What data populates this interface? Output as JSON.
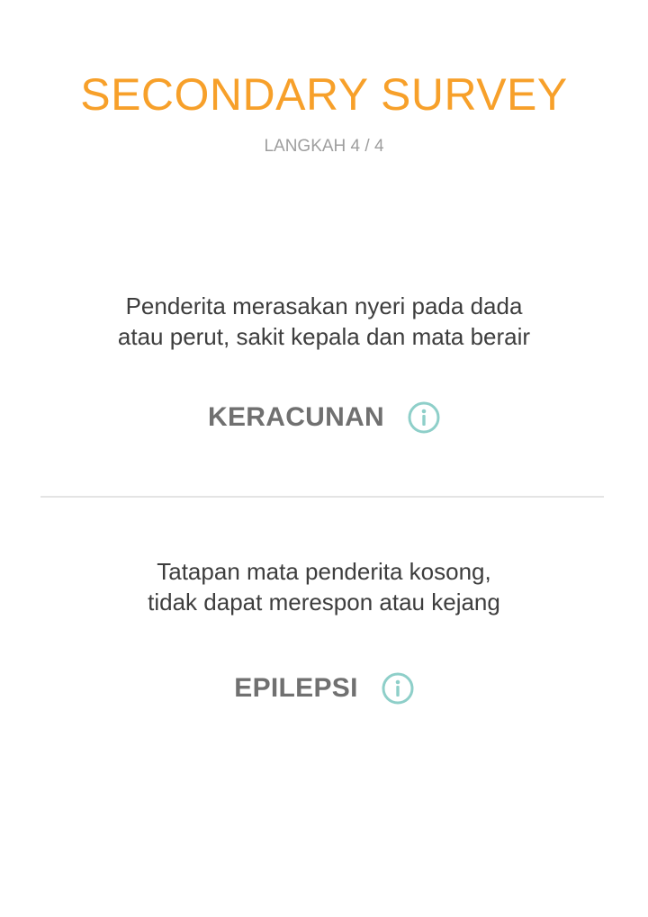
{
  "header": {
    "title": "SECONDARY SURVEY",
    "step": "LANGKAH 4 / 4"
  },
  "items": [
    {
      "condition_lines": [
        "Penderita merasakan nyeri pada dada",
        "atau perut, sakit kepala dan mata berair"
      ],
      "diagnosis": "KERACUNAN",
      "icon": "info-icon"
    },
    {
      "condition_lines": [
        "Tatapan mata penderita kosong,",
        "tidak dapat merespon atau kejang"
      ],
      "diagnosis": "EPILEPSI",
      "icon": "info-icon"
    }
  ],
  "colors": {
    "accent": "#f7a02a",
    "info_icon": "#8ecfc9",
    "diagnosis_text": "#707070",
    "body_text": "#3d3d3d",
    "divider": "#e4e4e4"
  }
}
